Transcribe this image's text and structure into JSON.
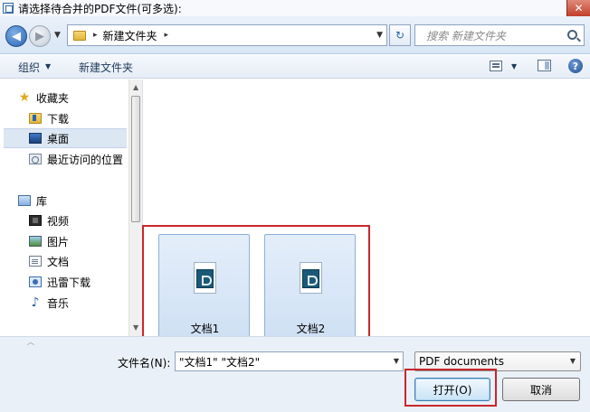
{
  "window": {
    "title": "请选择待合并的PDF文件(可多选):",
    "close_label": "✕"
  },
  "address": {
    "path": "新建文件夹",
    "separator": "▸",
    "search_placeholder": "搜索 新建文件夹"
  },
  "toolbar": {
    "organize_label": "组织",
    "new_folder_label": "新建文件夹"
  },
  "sidebar": {
    "items": [
      {
        "label": "收藏夹",
        "icon": "star-icon"
      },
      {
        "label": "下载",
        "icon": "download-folder-icon"
      },
      {
        "label": "桌面",
        "icon": "desktop-icon",
        "selected": true
      },
      {
        "label": "最近访问的位置",
        "icon": "recent-places-icon"
      },
      {
        "label": "库",
        "icon": "library-icon"
      },
      {
        "label": "视频",
        "icon": "video-icon"
      },
      {
        "label": "图片",
        "icon": "pictures-icon"
      },
      {
        "label": "文档",
        "icon": "documents-icon"
      },
      {
        "label": "迅雷下载",
        "icon": "xunlei-download-icon"
      },
      {
        "label": "音乐",
        "icon": "music-icon"
      }
    ]
  },
  "files": [
    {
      "name": "文档1",
      "icon": "pdf-file-icon"
    },
    {
      "name": "文档2",
      "icon": "pdf-file-icon"
    }
  ],
  "bottom": {
    "filename_label": "文件名(N):",
    "filename_value": "\"文档1\" \"文档2\"",
    "filetype_value": "PDF documents",
    "open_label": "打开(O)",
    "cancel_label": "取消"
  },
  "colors": {
    "highlight_red": "#c8262c",
    "selection_blue": "#dce7f4"
  }
}
